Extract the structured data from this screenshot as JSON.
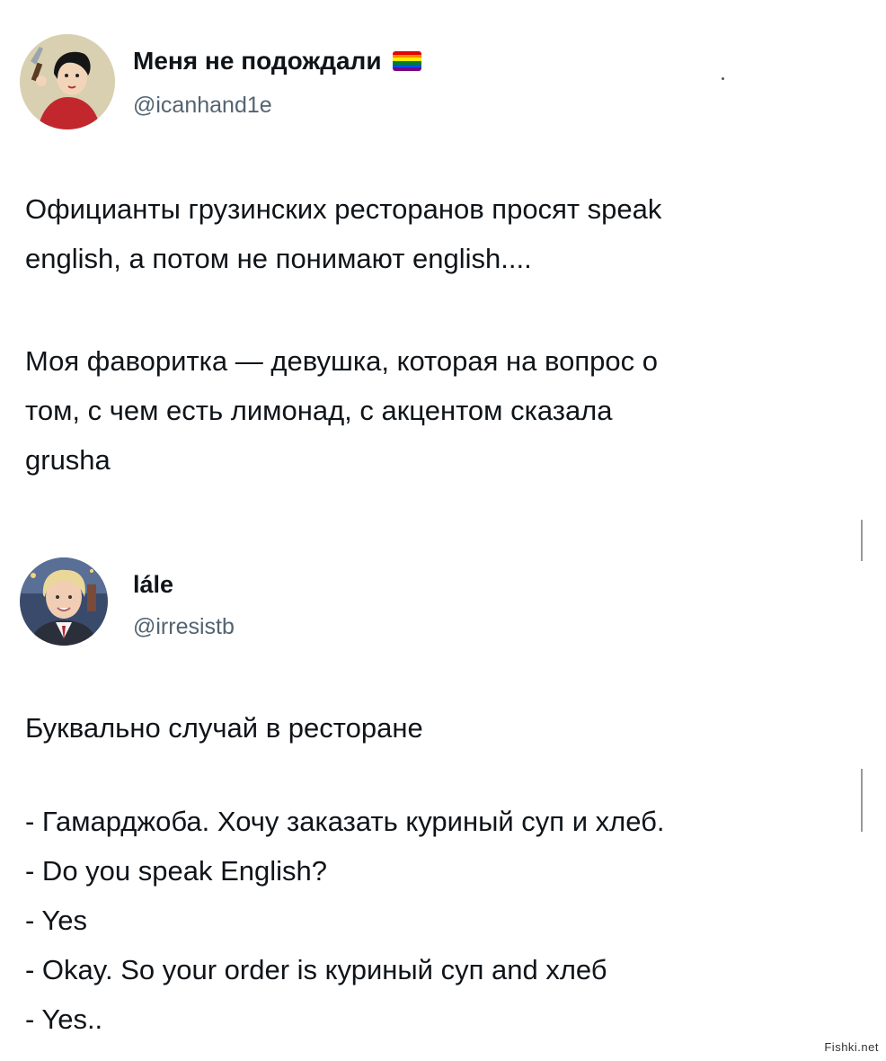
{
  "tweets": [
    {
      "display_name": "Меня не подождали",
      "handle": "@icanhand1e",
      "flag": "rainbow-flag-icon",
      "paragraphs": [
        "Официанты грузинских ресторанов просят speak english, а потом не понимают english....",
        "Моя фаворитка — девушка, которая на вопрос о том, с чем есть лимонад, с акцентом сказала grusha"
      ],
      "lines_p1": [
        "Официанты грузинских ресторанов просят speak",
        "english, а потом не понимают english...."
      ],
      "lines_p2": [
        "Моя фаворитка — девушка, которая на вопрос о",
        "том, с чем есть лимонад, с акцентом сказала",
        "grusha"
      ]
    },
    {
      "display_name": "lále",
      "handle": "@irresistb",
      "intro": "Буквально случай в ресторане",
      "dialogue": [
        "- Гамарджоба. Хочу заказать куриный суп и хлеб.",
        "- Do you speak English?",
        "- Yes",
        "- Okay. So your order is куриный суп and хлеб",
        "- Yes.."
      ]
    }
  ],
  "watermark": "Fishki.net",
  "colors": {
    "text": "#0f1419",
    "secondary": "#536471",
    "background": "#ffffff"
  }
}
